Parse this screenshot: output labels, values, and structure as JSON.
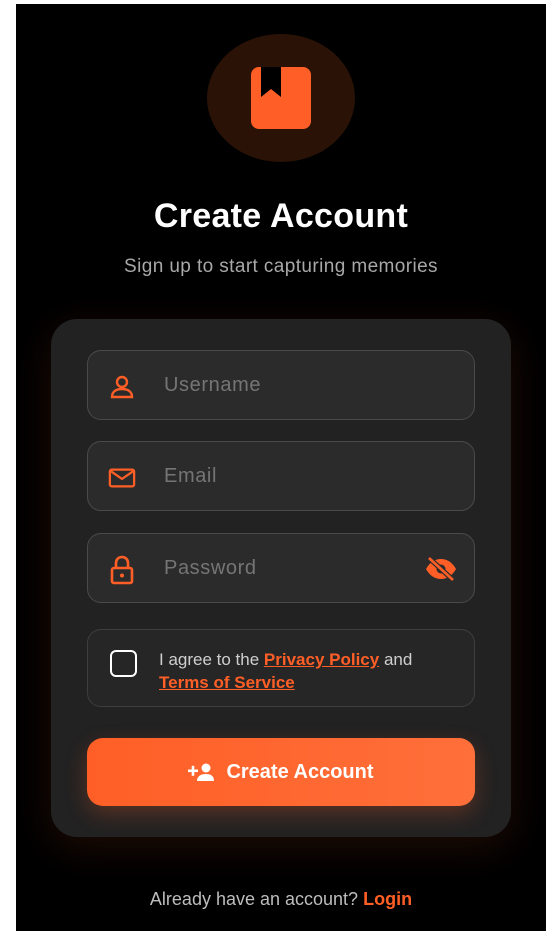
{
  "header": {
    "title": "Create Account",
    "subtitle": "Sign up to start capturing memories",
    "logo_icon": "bookmark-book-icon"
  },
  "form": {
    "username": {
      "placeholder": "Username",
      "icon": "person-icon"
    },
    "email": {
      "placeholder": "Email",
      "icon": "mail-icon"
    },
    "password": {
      "placeholder": "Password",
      "icon": "lock-icon",
      "toggle_icon": "eye-off-icon"
    },
    "agreement": {
      "checked": false,
      "prefix": "I agree to the ",
      "privacy_label": "Privacy Policy",
      "middle": " and",
      "terms_label": "Terms of Service"
    },
    "submit_label": "Create Account",
    "submit_icon": "add-person-icon"
  },
  "footer": {
    "prompt": "Already have an account? ",
    "login_label": "Login"
  },
  "colors": {
    "accent": "#ff5f26",
    "background": "#000000",
    "card": "#222222"
  }
}
